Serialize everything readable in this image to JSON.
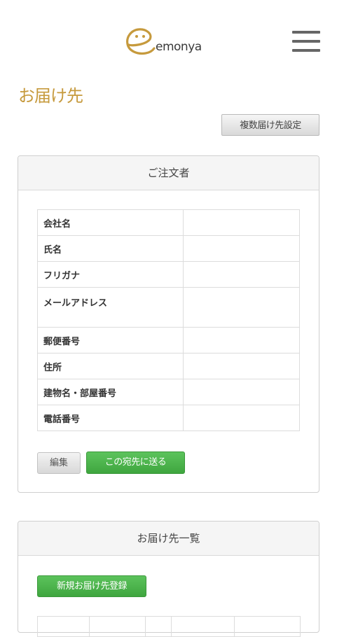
{
  "header": {
    "logo_text": "emonya",
    "logo_icon": "smiley-e-logo",
    "menu_icon": "hamburger-menu-icon"
  },
  "page": {
    "title": "お届け先",
    "multi_address_button": "複数届け先設定"
  },
  "orderer_panel": {
    "heading": "ご注文者",
    "fields": [
      {
        "label": "会社名",
        "value": ""
      },
      {
        "label": "氏名",
        "value": ""
      },
      {
        "label": "フリガナ",
        "value": ""
      },
      {
        "label": "メールアドレス",
        "value": ""
      },
      {
        "label": "郵便番号",
        "value": ""
      },
      {
        "label": "住所",
        "value": ""
      },
      {
        "label": "建物名・部屋番号",
        "value": ""
      },
      {
        "label": "電話番号",
        "value": ""
      }
    ],
    "edit_button": "編集",
    "send_button": "この宛先に送る"
  },
  "address_list_panel": {
    "heading": "お届け先一覧",
    "new_button": "新規お届け先登録"
  },
  "colors": {
    "title": "#c69a3d",
    "accent_green": "#4cb04c",
    "logo": "#c69a3d"
  }
}
